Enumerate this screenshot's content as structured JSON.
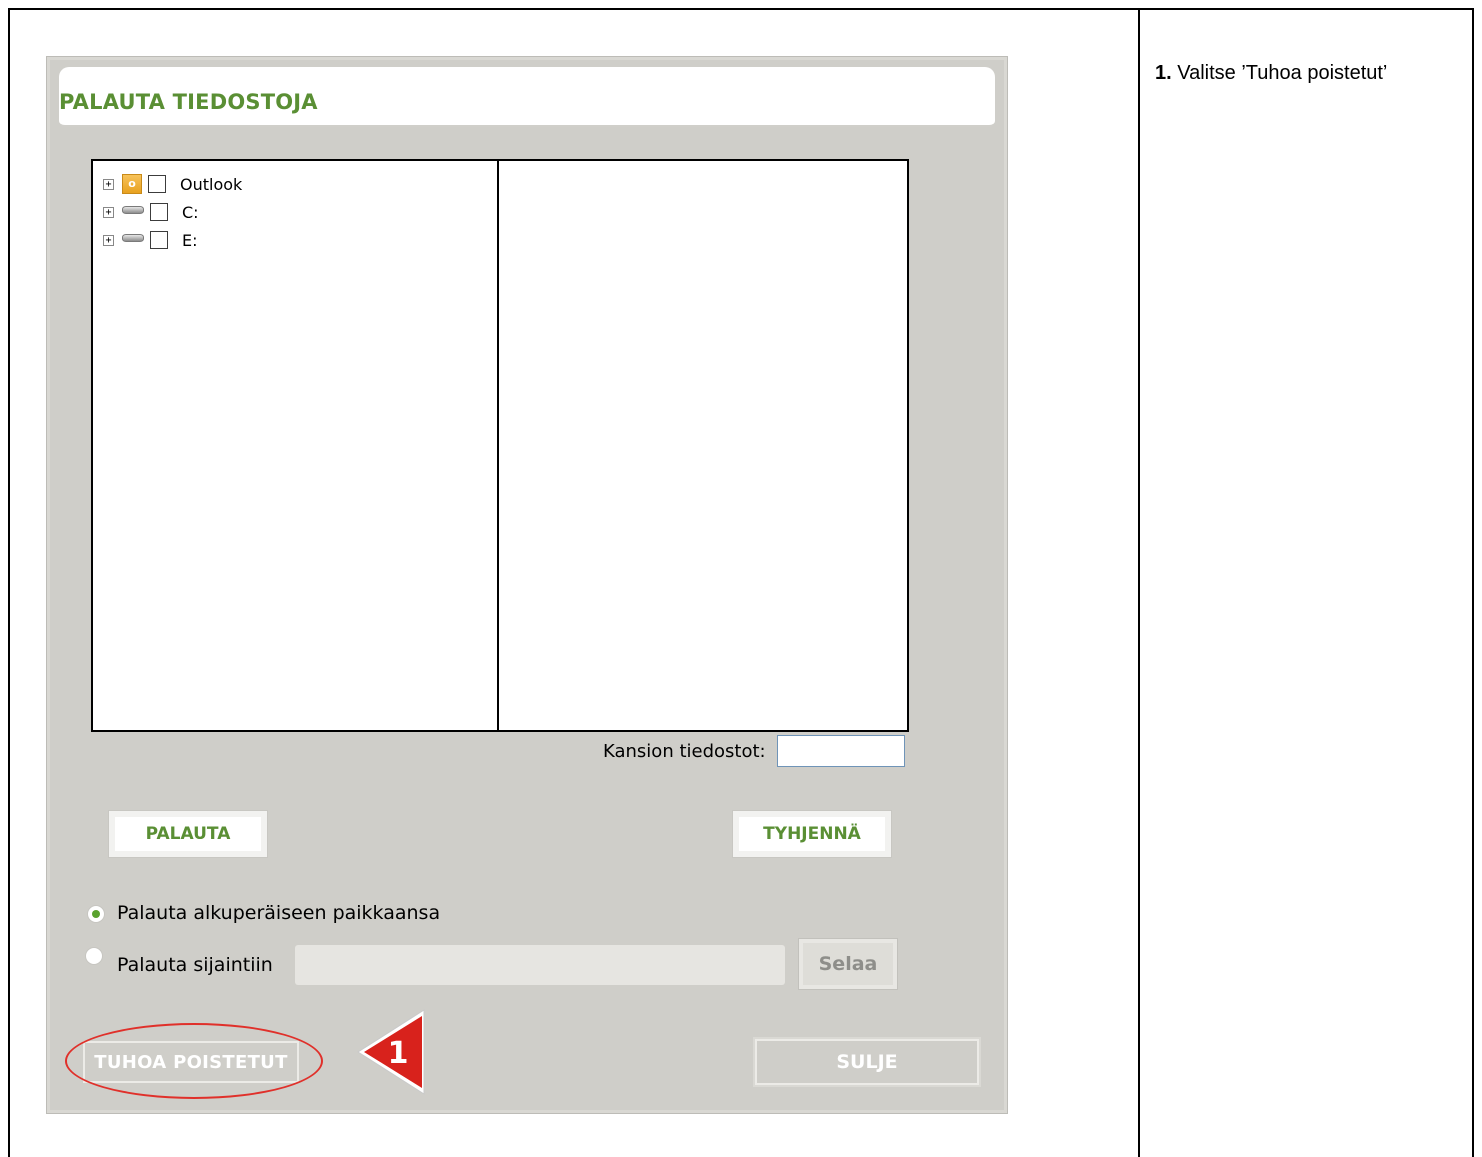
{
  "instruction": {
    "step_number": "1.",
    "text": "Valitse ’Tuhoa poistetut’"
  },
  "dialog": {
    "title": "PALAUTA TIEDOSTOJA",
    "tree": [
      {
        "label": "Outlook",
        "icon": "outlook-icon",
        "expanded": false,
        "checked": false
      },
      {
        "label": "C:",
        "icon": "drive-icon",
        "expanded": false,
        "checked": false
      },
      {
        "label": "E:",
        "icon": "drive-icon",
        "expanded": false,
        "checked": false
      }
    ],
    "folder_files_label": "Kansion tiedostot:",
    "folder_files_value": "",
    "buttons": {
      "restore": "PALAUTA",
      "clear": "TYHJENNÄ",
      "browse": "Selaa",
      "delete_removed": "TUHOA POISTETUT",
      "close": "SULJE"
    },
    "options": {
      "original_location": "Palauta alkuperäiseen paikkaansa",
      "to_location": "Palauta sijaintiin",
      "selected": "original_location",
      "path_value": ""
    }
  },
  "annotation": {
    "callout_number": "1",
    "highlight_color": "#e0302a"
  },
  "colors": {
    "accent_green": "#5a8f34",
    "dialog_bg": "#cfcec9",
    "radio_selected": "#5aa22e"
  }
}
